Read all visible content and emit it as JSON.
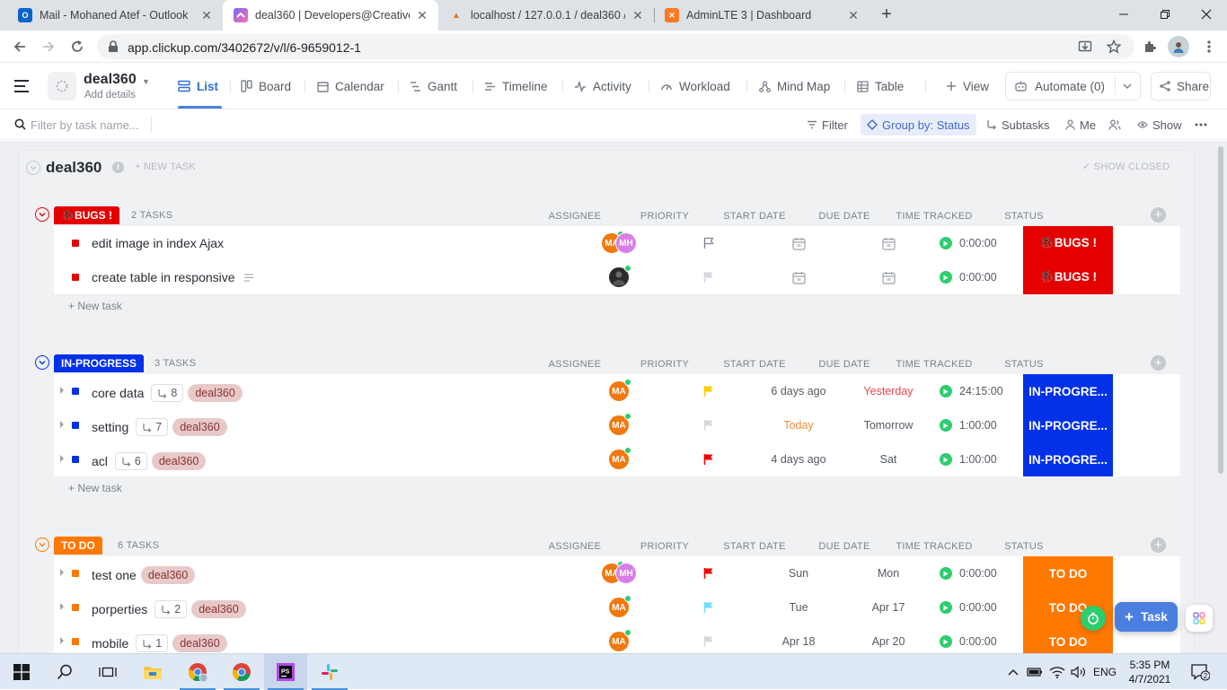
{
  "browser": {
    "tabs": [
      {
        "title": "Mail - Mohaned Atef - Outlook",
        "icon": "outlook-icon",
        "active": false
      },
      {
        "title": "deal360 | Developers@Creative-I",
        "icon": "clickup-icon",
        "active": true
      },
      {
        "title": "localhost / 127.0.0.1 / deal360 / l",
        "icon": "phpmyadmin-icon",
        "active": false
      },
      {
        "title": "AdminLTE 3 | Dashboard",
        "icon": "xampp-icon",
        "active": false
      }
    ],
    "url": "app.clickup.com/3402672/v/l/6-9659012-1"
  },
  "header": {
    "list_title": "deal360",
    "add_details": "Add details",
    "views": [
      {
        "label": "List",
        "icon": "list-icon"
      },
      {
        "label": "Board",
        "icon": "board-icon"
      },
      {
        "label": "Calendar",
        "icon": "calendar-icon"
      },
      {
        "label": "Gantt",
        "icon": "gantt-icon"
      },
      {
        "label": "Timeline",
        "icon": "timeline-icon"
      },
      {
        "label": "Activity",
        "icon": "activity-icon"
      },
      {
        "label": "Workload",
        "icon": "workload-icon"
      },
      {
        "label": "Mind Map",
        "icon": "mindmap-icon"
      },
      {
        "label": "Table",
        "icon": "table-icon"
      }
    ],
    "add_view": "View",
    "automate": "Automate (0)",
    "share": "Share"
  },
  "filterbar": {
    "search_placeholder": "Filter by task name...",
    "filter": "Filter",
    "group_by": "Group by: Status",
    "subtasks": "Subtasks",
    "me": "Me",
    "show": "Show"
  },
  "list": {
    "name": "deal360",
    "new_task": "+ NEW TASK",
    "show_closed": "SHOW CLOSED"
  },
  "columns": {
    "assignee": "ASSIGNEE",
    "priority": "PRIORITY",
    "start_date": "START DATE",
    "due_date": "DUE DATE",
    "time_tracked": "TIME TRACKED",
    "status": "STATUS"
  },
  "groups": [
    {
      "label": "🐞BUGS !",
      "count": "2 TASKS",
      "color": "#e50000",
      "new_task": "+ New task",
      "tasks": [
        {
          "name": "edit image in index Ajax",
          "subtasks": "",
          "tag": "",
          "has_desc": false,
          "assignees": [
            {
              "initials": "MA",
              "color": "#f0790e"
            },
            {
              "initials": "MH",
              "color": "#d97ee8"
            }
          ],
          "priority": "none",
          "start": "",
          "due": "",
          "time": "0:00:00",
          "status": "🐞BUGS !"
        },
        {
          "name": "create table in responsive",
          "subtasks": "",
          "tag": "",
          "has_desc": true,
          "assignees": [
            {
              "initials": "",
              "color": "#2b2b2b"
            }
          ],
          "priority": "none-gray",
          "start": "",
          "due": "",
          "time": "0:00:00",
          "status": "🐞BUGS !"
        }
      ]
    },
    {
      "label": "IN-PROGRESS",
      "count": "3 TASKS",
      "color": "#0231e8",
      "new_task": "+ New task",
      "tasks": [
        {
          "name": "core data",
          "subtasks": "8",
          "tag": "deal360",
          "has_desc": false,
          "assignees": [
            {
              "initials": "MA",
              "color": "#f0790e"
            }
          ],
          "priority": "#ffcc00",
          "start": "6 days ago",
          "due": "Yesterday",
          "due_color": "#e5484d",
          "time": "24:15:00",
          "status": "IN-PROGRE..."
        },
        {
          "name": "setting",
          "subtasks": "7",
          "tag": "deal360",
          "has_desc": false,
          "assignees": [
            {
              "initials": "MA",
              "color": "#f0790e"
            }
          ],
          "priority": "none-gray",
          "start": "Today",
          "start_color": "#f08c3c",
          "due": "Tomorrow",
          "time": "1:00:00",
          "status": "IN-PROGRE..."
        },
        {
          "name": "acl",
          "subtasks": "6",
          "tag": "deal360",
          "has_desc": false,
          "assignees": [
            {
              "initials": "MA",
              "color": "#f0790e"
            }
          ],
          "priority": "#f50000",
          "start": "4 days ago",
          "due": "Sat",
          "time": "1:00:00",
          "status": "IN-PROGRE..."
        }
      ]
    },
    {
      "label": "TO DO",
      "count": "6 TASKS",
      "color": "#ff7800",
      "new_task": "",
      "tasks": [
        {
          "name": "test one",
          "subtasks": "",
          "tag": "deal360",
          "has_desc": false,
          "assignees": [
            {
              "initials": "MA",
              "color": "#f0790e"
            },
            {
              "initials": "MH",
              "color": "#d97ee8"
            }
          ],
          "priority": "#f50000",
          "start": "Sun",
          "due": "Mon",
          "time": "0:00:00",
          "status": "TO DO"
        },
        {
          "name": "porperties",
          "subtasks": "2",
          "tag": "deal360",
          "has_desc": false,
          "assignees": [
            {
              "initials": "MA",
              "color": "#f0790e"
            }
          ],
          "priority": "#6fddff",
          "start": "Tue",
          "due": "Apr 17",
          "time": "0:00:00",
          "status": "TO DO"
        },
        {
          "name": "mobile",
          "subtasks": "1",
          "tag": "deal360",
          "has_desc": false,
          "assignees": [
            {
              "initials": "MA",
              "color": "#f0790e"
            }
          ],
          "priority": "none-gray",
          "start": "Apr 18",
          "due": "Apr 20",
          "time": "0:00:00",
          "status": "TO DO"
        }
      ]
    }
  ],
  "floating": {
    "task_button": "Task"
  },
  "taskbar": {
    "language": "ENG",
    "time": "5:35 PM",
    "date": "4/7/2021",
    "notifications": "2"
  }
}
